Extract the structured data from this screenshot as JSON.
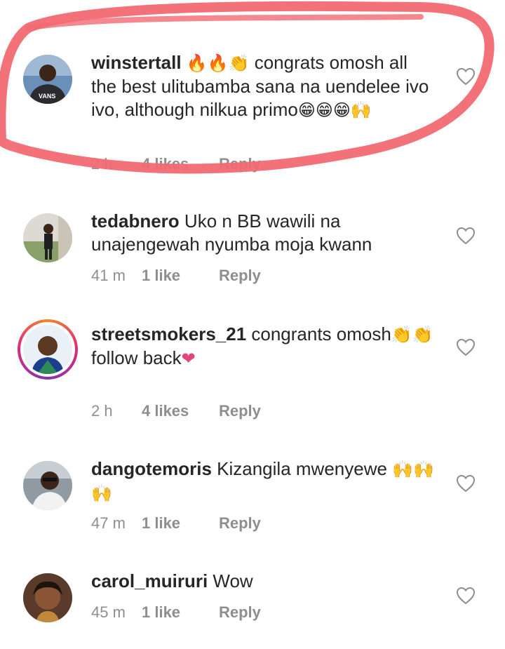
{
  "comments": [
    {
      "username": "winstertall",
      "text_start": "",
      "emojis_start": "🔥🔥👏",
      "text": " congrats omosh all the best ulitubamba sana na uendelee ivo ivo, although nilkua primo",
      "emojis_end": "😁😁😁🙌",
      "time": "2 h",
      "likes": "4 likes",
      "reply": "Reply",
      "avatar_label": "VANS"
    },
    {
      "username": "tedabnero",
      "text": " Uko n BB wawili na unajengewah nyumba moja kwann",
      "time": "41 m",
      "likes": "1 like",
      "reply": "Reply"
    },
    {
      "username": "streetsmokers_21",
      "text": " congrants omosh",
      "emojis_end": "👏👏",
      "line2": "follow back",
      "line2_emoji": "❤",
      "time": "2 h",
      "likes": "4 likes",
      "reply": "Reply"
    },
    {
      "username": "dangotemoris",
      "text": " Kizangila mwenyewe ",
      "emojis_end": "🙌🙌🙌",
      "time": "47 m",
      "likes": "1 like",
      "reply": "Reply"
    },
    {
      "username": "carol_muiruri",
      "text": " Wow",
      "time": "45 m",
      "likes": "1 like",
      "reply": "Reply"
    }
  ],
  "colors": {
    "highlight": "#f26a72",
    "meta": "#8e8e8e",
    "text": "#262626",
    "story_ring": "#dd2a7b"
  }
}
